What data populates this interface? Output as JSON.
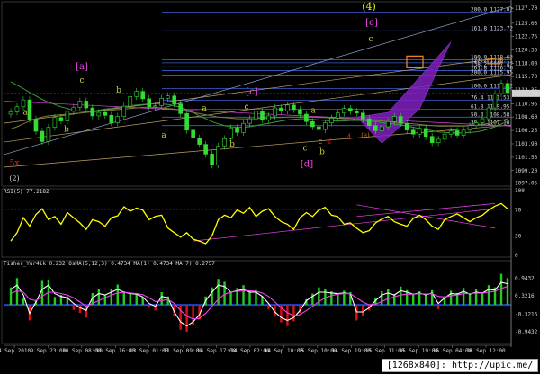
{
  "window": {
    "symbol_title": "",
    "watermark": "[1268x840]: http://upic.me/"
  },
  "chart_data": [
    {
      "type": "line",
      "name": "price",
      "xlabel": "",
      "ylabel": "",
      "y_ticks": [
        1127.7,
        1125.05,
        1122.75,
        1120.35,
        1118.0,
        1115.7,
        1113.35,
        1110.95,
        1108.6,
        1106.25,
        1103.9,
        1101.55,
        1099.2,
        1097.05
      ],
      "ylim": [
        1096.8,
        1128.5
      ],
      "current_price": 1112.75,
      "x_ticks": [
        "4 Sep 2010",
        "9 Sep 23:00",
        "10 Sep 08:00",
        "10 Sep 16:00",
        "13 Sep 01:00",
        "11 Sep 09:00",
        "14 Sep 17:00",
        "14 Sep 02:00",
        "14 Sep 10:00",
        "15 Sep 10:00",
        "14 Sep 19:00",
        "15 Sep 11:00",
        "15 Sep 19:00",
        "16 Sep 04:00",
        "16 Sep 12:00"
      ],
      "close": [
        1109.5,
        1110.4,
        1111.6,
        1108.2,
        1106.1,
        1104.3,
        1106.8,
        1108.5,
        1107.9,
        1109.6,
        1110.3,
        1111.4,
        1110.2,
        1108.8,
        1109.4,
        1108.9,
        1107.6,
        1108.7,
        1110.5,
        1112.2,
        1113.1,
        1111.8,
        1110.4,
        1110.6,
        1111.9,
        1112.3,
        1110.9,
        1109.2,
        1106.3,
        1104.9,
        1103.8,
        1102.1,
        1100.2,
        1103.5,
        1104.8,
        1106.7,
        1105.9,
        1107.5,
        1108.3,
        1109.6,
        1108.1,
        1108.8,
        1110.2,
        1109.7,
        1110.7,
        1109.9,
        1109.1,
        1107.8,
        1106.9,
        1106.4,
        1107.6,
        1108.4,
        1109.3,
        1110.1,
        1109.6,
        1109.3,
        1108.3,
        1107.1,
        1106.2,
        1106.9,
        1107.8,
        1108.7,
        1107.5,
        1106.3,
        1105.6,
        1106.6,
        1105.2,
        1104.1,
        1104.7,
        1105.6,
        1106.2,
        1105.4,
        1106.3,
        1107.1,
        1107.6,
        1108.3,
        1110.2,
        1112.7,
        1114.5,
        1112.9
      ],
      "moving_averages": [
        {
          "color": "#3a9a3a",
          "values": [
            1114.8,
            1114.2,
            1113.6,
            1112.9,
            1112.3,
            1111.7,
            1111.2,
            1110.8,
            1110.4,
            1110.1,
            1109.8,
            1109.6,
            1109.5,
            1109.6,
            1109.8,
            1110.0,
            1110.1,
            1110.3,
            1110.4,
            1110.6,
            1110.7,
            1110.8,
            1110.9,
            1110.9,
            1110.9,
            1110.8,
            1110.6,
            1110.3,
            1109.9,
            1109.4,
            1108.8,
            1108.3,
            1107.8,
            1107.4,
            1107.1,
            1106.9,
            1106.8,
            1106.8,
            1106.9,
            1107.1,
            1107.3,
            1107.5,
            1107.7,
            1107.9,
            1108.1,
            1108.2,
            1108.3,
            1108.3,
            1108.2,
            1108.1,
            1108.0,
            1107.9,
            1107.9,
            1107.9,
            1108.0,
            1108.0,
            1108.0,
            1107.9,
            1107.8,
            1107.6,
            1107.5,
            1107.4,
            1107.2,
            1107.0,
            1106.8,
            1106.6,
            1106.4,
            1106.2,
            1106.0,
            1105.9,
            1105.8,
            1105.8,
            1105.8,
            1105.9,
            1106.0,
            1106.2,
            1106.5,
            1106.9,
            1107.4,
            1107.8
          ]
        },
        {
          "color": "#7a7a3a",
          "values": [
            1106.5,
            1106.9,
            1107.4,
            1107.9,
            1108.3,
            1108.6,
            1108.8,
            1108.9,
            1109.0,
            1109.1,
            1109.2,
            1109.3,
            1109.4,
            1109.5,
            1109.6,
            1109.7,
            1109.8,
            1109.9,
            1110.0,
            1110.1,
            1110.2,
            1110.3,
            1110.3,
            1110.3,
            1110.2,
            1110.1,
            1110.0,
            1109.8,
            1109.6,
            1109.4,
            1109.2,
            1109.0,
            1108.8,
            1108.6,
            1108.5,
            1108.4,
            1108.3,
            1108.3,
            1108.3,
            1108.3,
            1108.4,
            1108.4,
            1108.5,
            1108.5,
            1108.6,
            1108.6,
            1108.6,
            1108.6,
            1108.6,
            1108.5,
            1108.5,
            1108.4,
            1108.4,
            1108.3,
            1108.3,
            1108.2,
            1108.2,
            1108.1,
            1108.0,
            1107.9,
            1107.8,
            1107.7,
            1107.6,
            1107.5,
            1107.4,
            1107.3,
            1107.2,
            1107.1,
            1107.0,
            1107.0,
            1107.0,
            1107.0,
            1107.0,
            1107.1,
            1107.2,
            1107.3,
            1107.5,
            1107.7,
            1108.0,
            1108.3
          ]
        }
      ],
      "fib_levels": [
        {
          "price": 1127.02,
          "label": "200.0  1127.02"
        },
        {
          "price": 1123.72,
          "label": "161.8  1123.72"
        },
        {
          "price": 1118.63,
          "label": "100.0  1118.63"
        },
        {
          "price": 1118.11,
          "label": "127.2  1118.11"
        },
        {
          "price": 1117.42,
          "label": "138.2  1117.42"
        },
        {
          "price": 1116.76,
          "label": "161.8  1116.76"
        },
        {
          "price": 1115.95,
          "label": "200.0  1115.95"
        },
        {
          "price": 1113.62,
          "label": "100.0  1113.62"
        },
        {
          "price": 1111.53,
          "label": "76.4  1111.53"
        },
        {
          "price": 1109.95,
          "label": "61.8  1109.95"
        },
        {
          "price": 1108.58,
          "label": "50.0  1108.58"
        },
        {
          "price": 1107.1,
          "label": "38.2  1107.10"
        }
      ],
      "wave_labels": [
        {
          "text": "(4)",
          "color": "#f0f000",
          "x": 410,
          "y": 1127.4,
          "size": 11
        },
        {
          "text": "[e]",
          "color": "#ee44ee",
          "x": 413,
          "y": 1124.7,
          "size": 10
        },
        {
          "text": "c",
          "color": "#cccc44",
          "x": 412,
          "y": 1121.9,
          "size": 9
        },
        {
          "text": "[a]",
          "color": "#ee44ee",
          "x": 91,
          "y": 1117.0,
          "size": 10
        },
        {
          "text": "c",
          "color": "#cccc44",
          "x": 91,
          "y": 1114.6,
          "size": 9
        },
        {
          "text": "b",
          "color": "#cccc44",
          "x": 132,
          "y": 1112.9,
          "size": 9
        },
        {
          "text": "a",
          "color": "#cccc44",
          "x": 28,
          "y": 1109.0,
          "size": 9
        },
        {
          "text": "b",
          "color": "#cccc44",
          "x": 74,
          "y": 1106.0,
          "size": 9
        },
        {
          "text": "[c]",
          "color": "#ee44ee",
          "x": 280,
          "y": 1112.6,
          "size": 10
        },
        {
          "text": "c",
          "color": "#cccc44",
          "x": 274,
          "y": 1110.0,
          "size": 9
        },
        {
          "text": "a",
          "color": "#cccc44",
          "x": 227,
          "y": 1109.7,
          "size": 9
        },
        {
          "text": "a",
          "color": "#cccc44",
          "x": 348,
          "y": 1109.3,
          "size": 9
        },
        {
          "text": "b",
          "color": "#cccc44",
          "x": 258,
          "y": 1103.4,
          "size": 9
        },
        {
          "text": "a",
          "color": "#cccc44",
          "x": 182,
          "y": 1105.0,
          "size": 9
        },
        {
          "text": "c",
          "color": "#cccc44",
          "x": 339,
          "y": 1102.7,
          "size": 9
        },
        {
          "text": "c",
          "color": "#cccc44",
          "x": 356,
          "y": 1103.9,
          "size": 8
        },
        {
          "text": "b",
          "color": "#cccc44",
          "x": 358,
          "y": 1102.1,
          "size": 9
        },
        {
          "text": "[d]",
          "color": "#ee44ee",
          "x": 341,
          "y": 1099.9,
          "size": 10
        },
        {
          "text": "2",
          "color": "#ee2222",
          "x": 366,
          "y": 1104.0,
          "size": 8
        },
        {
          "text": "4",
          "color": "#ee2222",
          "x": 388,
          "y": 1104.7,
          "size": 8
        },
        {
          "text": "(e)",
          "color": "#cc7722",
          "x": 406,
          "y": 1105.1,
          "size": 7
        },
        {
          "text": "5x",
          "color": "#ee2222",
          "x": 16,
          "y": 1100.1,
          "size": 9
        },
        {
          "text": "(2)",
          "color": "#cccccc",
          "x": 16,
          "y": 1097.4,
          "size": 8
        }
      ]
    },
    {
      "type": "line",
      "name": "rsi",
      "title": "RSI(5) 77.2182",
      "ylim": [
        0,
        100
      ],
      "y_ticks": [
        100,
        70,
        30,
        0
      ],
      "series": [
        {
          "color": "#ffff00",
          "values": [
            22,
            35,
            58,
            45,
            63,
            72,
            55,
            60,
            48,
            66,
            58,
            50,
            40,
            55,
            52,
            45,
            58,
            61,
            75,
            68,
            73,
            70,
            55,
            60,
            62,
            42,
            35,
            28,
            35,
            25,
            22,
            18,
            30,
            55,
            62,
            58,
            70,
            65,
            74,
            60,
            68,
            72,
            60,
            52,
            48,
            40,
            58,
            66,
            60,
            70,
            74,
            62,
            60,
            48,
            50,
            42,
            35,
            38,
            50,
            56,
            60,
            52,
            48,
            45,
            57,
            62,
            55,
            45,
            40,
            55,
            60,
            64,
            58,
            52,
            58,
            62,
            70,
            76,
            80,
            72
          ]
        }
      ]
    },
    {
      "type": "bar",
      "name": "fisher",
      "title": "Fisher_Yur4ik 0.232  OsMA(5,12,3) 0.4734  MA(1) 0.4734  MA(7) 0.2757",
      "ylim": [
        -1.3,
        1.5
      ],
      "y_ticks": [
        0.9432,
        0.3216,
        -0.3216,
        -0.9432
      ],
      "histogram": [
        0.62,
        0.95,
        0.25,
        -0.55,
        0.18,
        0.85,
        0.9,
        0.28,
        0.35,
        0.3,
        -0.18,
        -0.28,
        -0.45,
        0.42,
        0.55,
        0.35,
        0.58,
        0.72,
        0.48,
        0.4,
        0.42,
        0.28,
        -0.1,
        -0.2,
        0.45,
        0.3,
        -0.4,
        -0.88,
        -0.95,
        -0.7,
        -0.52,
        0.3,
        0.62,
        0.92,
        0.82,
        0.45,
        0.6,
        0.7,
        0.48,
        0.52,
        0.3,
        -0.15,
        -0.42,
        -0.62,
        -0.75,
        -0.58,
        -0.3,
        0.2,
        0.4,
        0.62,
        0.55,
        0.48,
        0.42,
        0.5,
        0.45,
        -0.55,
        -0.38,
        -0.2,
        0.25,
        0.48,
        0.55,
        0.38,
        0.65,
        0.52,
        0.4,
        0.48,
        0.35,
        0.52,
        -0.15,
        0.3,
        0.5,
        0.42,
        0.6,
        0.38,
        0.55,
        0.45,
        0.7,
        0.62,
        1.1,
        0.95
      ],
      "series": [
        {
          "color": "#ffffff",
          "values": [
            0.55,
            0.7,
            0.35,
            -0.3,
            0.1,
            0.55,
            0.7,
            0.4,
            0.3,
            0.25,
            0.05,
            -0.1,
            -0.2,
            0.25,
            0.4,
            0.35,
            0.45,
            0.55,
            0.45,
            0.4,
            0.38,
            0.28,
            0.05,
            -0.05,
            0.3,
            0.25,
            -0.25,
            -0.6,
            -0.75,
            -0.6,
            -0.35,
            0.15,
            0.45,
            0.7,
            0.65,
            0.45,
            0.5,
            0.55,
            0.45,
            0.45,
            0.3,
            0.05,
            -0.25,
            -0.45,
            -0.55,
            -0.45,
            -0.2,
            0.15,
            0.3,
            0.45,
            0.45,
            0.42,
            0.4,
            0.42,
            0.4,
            -0.25,
            -0.25,
            -0.1,
            0.15,
            0.35,
            0.42,
            0.35,
            0.5,
            0.45,
            0.38,
            0.42,
            0.35,
            0.42,
            0.05,
            0.25,
            0.4,
            0.38,
            0.48,
            0.38,
            0.45,
            0.42,
            0.55,
            0.52,
            0.8,
            0.75
          ]
        },
        {
          "color": "#ee44ee",
          "values": [
            0.4,
            0.5,
            0.45,
            0.2,
            0.15,
            0.3,
            0.45,
            0.45,
            0.4,
            0.35,
            0.25,
            0.1,
            -0.05,
            0.05,
            0.15,
            0.25,
            0.35,
            0.42,
            0.45,
            0.42,
            0.4,
            0.36,
            0.25,
            0.12,
            0.15,
            0.2,
            0.05,
            -0.2,
            -0.4,
            -0.5,
            -0.48,
            -0.3,
            -0.05,
            0.2,
            0.38,
            0.45,
            0.48,
            0.5,
            0.5,
            0.48,
            0.42,
            0.3,
            0.1,
            -0.1,
            -0.28,
            -0.38,
            -0.35,
            -0.2,
            -0.05,
            0.12,
            0.25,
            0.33,
            0.38,
            0.4,
            0.4,
            0.25,
            0.1,
            0.0,
            0.02,
            0.12,
            0.22,
            0.28,
            0.35,
            0.38,
            0.38,
            0.4,
            0.38,
            0.4,
            0.3,
            0.28,
            0.32,
            0.35,
            0.4,
            0.4,
            0.42,
            0.42,
            0.45,
            0.48,
            0.58,
            0.65
          ]
        }
      ]
    }
  ]
}
